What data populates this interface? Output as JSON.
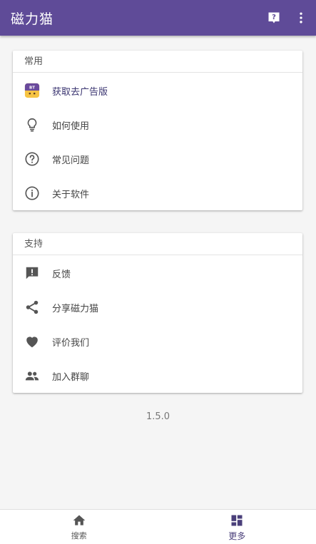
{
  "app": {
    "title": "磁力猫",
    "accent_color": "#5f4b98",
    "icons": {
      "help": "help-box-icon",
      "more": "more-vert-icon"
    }
  },
  "sections": {
    "common": {
      "header": "常用",
      "items": [
        {
          "label": "获取去广告版",
          "icon": "bt-cat-app-icon"
        },
        {
          "label": "如何使用",
          "icon": "lightbulb-icon"
        },
        {
          "label": "常见问题",
          "icon": "help-circle-icon"
        },
        {
          "label": "关于软件",
          "icon": "info-icon"
        }
      ]
    },
    "support": {
      "header": "支持",
      "items": [
        {
          "label": "反馈",
          "icon": "feedback-icon"
        },
        {
          "label": "分享磁力猫",
          "icon": "share-icon"
        },
        {
          "label": "评价我们",
          "icon": "heart-icon"
        },
        {
          "label": "加入群聊",
          "icon": "group-icon"
        }
      ]
    }
  },
  "version": "1.5.0",
  "bottom_nav": {
    "items": [
      {
        "label": "搜索",
        "icon": "home-icon",
        "active": false
      },
      {
        "label": "更多",
        "icon": "dashboard-icon",
        "active": true
      }
    ]
  }
}
